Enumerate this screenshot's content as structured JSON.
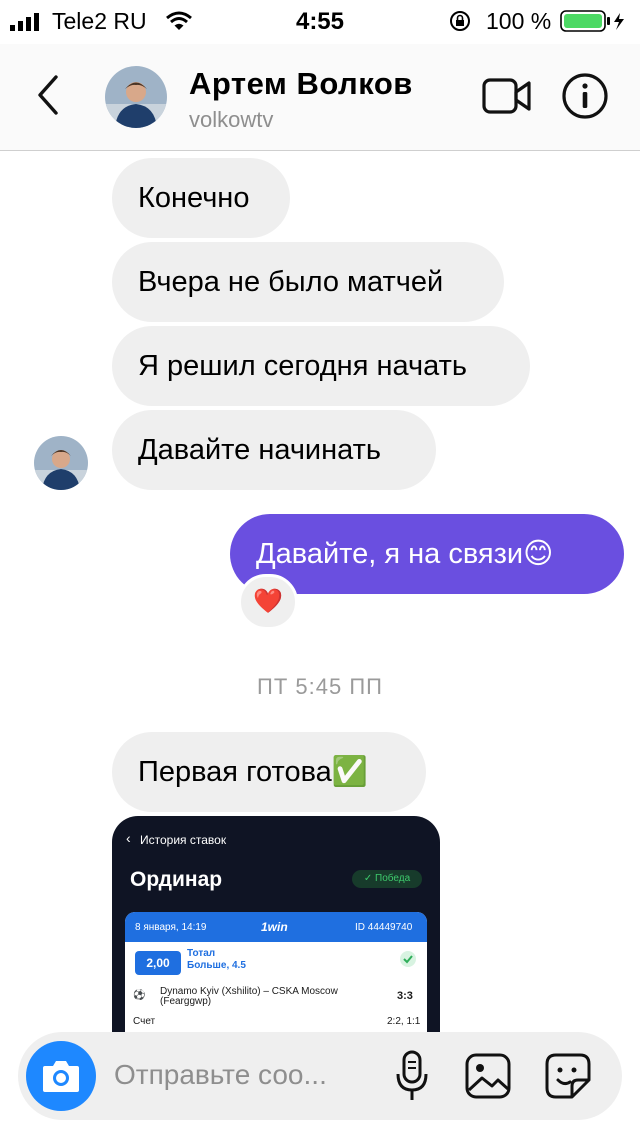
{
  "status": {
    "carrier": "Tele2 RU",
    "time": "4:55",
    "battery_pct": "100 %"
  },
  "header": {
    "name": "Артем Волков",
    "username": "volkowtv",
    "icons": [
      "back-chevron-icon",
      "video-call-icon",
      "info-icon"
    ]
  },
  "messages": [
    {
      "from": "them",
      "text": "Конечно"
    },
    {
      "from": "them",
      "text": "Вчера не было матчей"
    },
    {
      "from": "them",
      "text": "Я решил сегодня начать"
    },
    {
      "from": "them",
      "text": "Давайте начинать"
    },
    {
      "from": "me",
      "text": "Давайте, я на связи😊",
      "reaction": "❤️"
    },
    {
      "timestamp": "ПТ 5:45 ПП"
    },
    {
      "from": "them",
      "text": "Первая готова✅"
    }
  ],
  "shared_screenshot": {
    "nav_label": "История ставок",
    "title": "Ординар",
    "badge": "Победа",
    "date": "8 января, 14:19",
    "brand": "1win",
    "bet_id": "ID 44449740",
    "odds": "2,00",
    "market": "Тотал",
    "selection": "Больше, 4.5",
    "match": "Dynamo Kyiv (Xshilito) – CSKA Moscow (Fearggwp)",
    "score": "3:3",
    "score_label": "Счет",
    "score_detail": "2:2, 1:1"
  },
  "composer": {
    "placeholder": "Отправьте соо..."
  }
}
